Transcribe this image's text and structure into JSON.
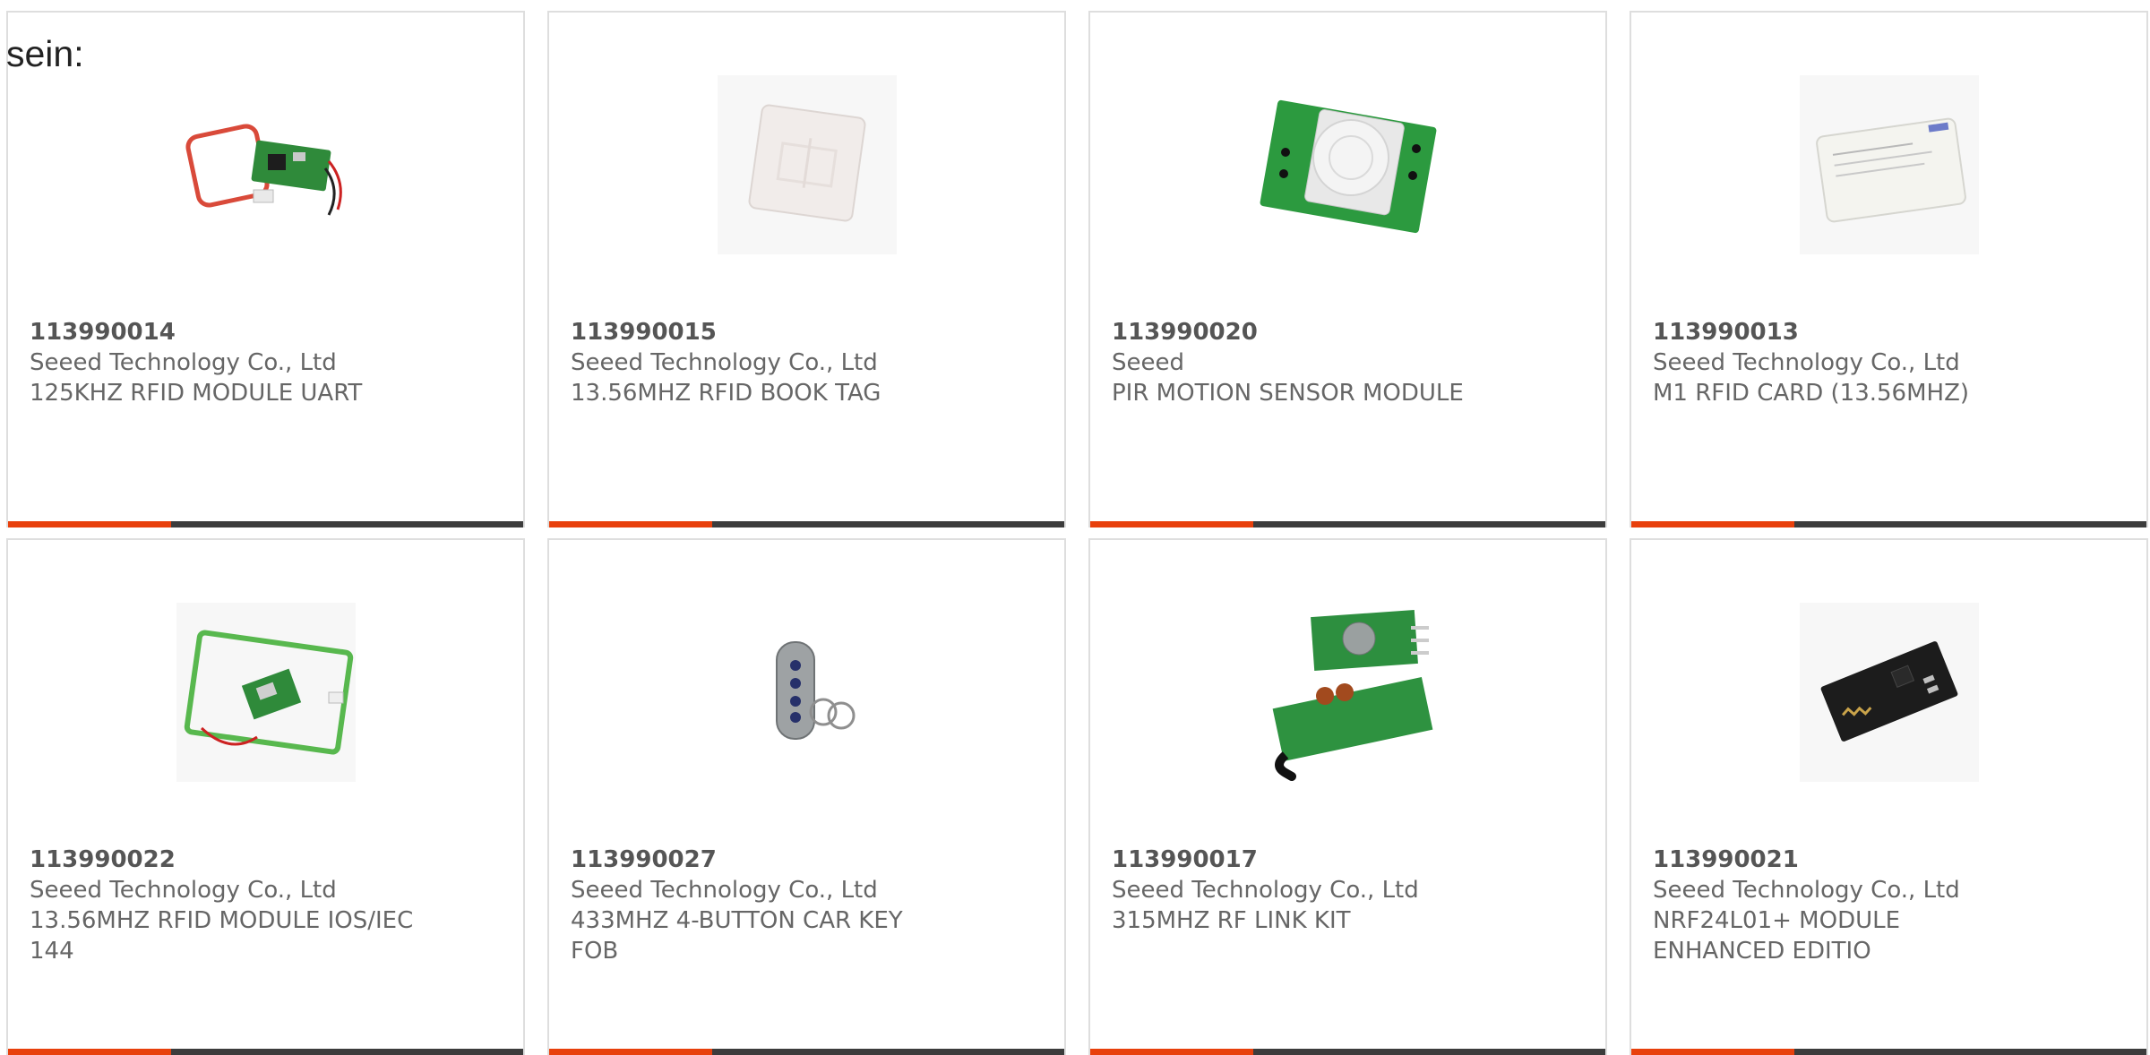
{
  "intro_text": "sein:",
  "colors": {
    "accent": "#e8400c",
    "bar": "#3c3c3c",
    "text": "#666666",
    "border": "#dedede"
  },
  "products": [
    {
      "part_number": "113990014",
      "manufacturer": "Seeed Technology Co., Ltd",
      "description": "125KHZ RFID MODULE UART",
      "icon": "rfid-module-image"
    },
    {
      "part_number": "113990015",
      "manufacturer": "Seeed Technology Co., Ltd",
      "description": "13.56MHZ RFID BOOK TAG",
      "icon": "rfid-tag-image"
    },
    {
      "part_number": "113990020",
      "manufacturer": "Seeed",
      "description": "PIR MOTION SENSOR MODULE",
      "icon": "pir-sensor-image"
    },
    {
      "part_number": "113990013",
      "manufacturer": "Seeed Technology Co., Ltd",
      "description": "M1 RFID CARD (13.56MHZ)",
      "icon": "rfid-card-image"
    },
    {
      "part_number": "113990022",
      "manufacturer": "Seeed Technology Co., Ltd",
      "description": "13.56MHZ RFID MODULE IOS/IEC 144",
      "icon": "rfid-module-image"
    },
    {
      "part_number": "113990027",
      "manufacturer": "Seeed Technology Co., Ltd",
      "description": "433MHZ 4-BUTTON CAR KEY FOB",
      "icon": "key-fob-image"
    },
    {
      "part_number": "113990017",
      "manufacturer": "Seeed Technology Co., Ltd",
      "description": "315MHZ RF LINK KIT",
      "icon": "rf-link-kit-image"
    },
    {
      "part_number": "113990021",
      "manufacturer": "Seeed Technology Co., Ltd",
      "description": "NRF24L01+ MODULE ENHANCED EDITIO",
      "icon": "nrf-module-image"
    }
  ]
}
